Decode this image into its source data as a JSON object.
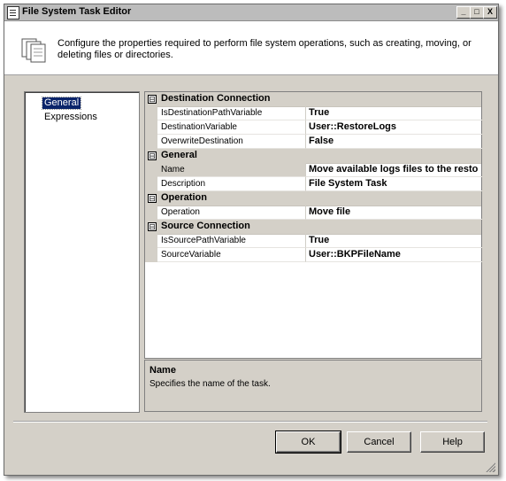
{
  "window": {
    "title": "File System Task Editor"
  },
  "header": {
    "icon": "document-stack-icon",
    "description": "Configure the properties required to perform file system operations, such as creating, moving, or deleting files or directories."
  },
  "nav": {
    "items": [
      {
        "label": "General",
        "selected": true
      },
      {
        "label": "Expressions",
        "selected": false
      }
    ]
  },
  "properties": [
    {
      "category": "Destination Connection",
      "rows": [
        {
          "name": "IsDestinationPathVariable",
          "value": "True"
        },
        {
          "name": "DestinationVariable",
          "value": "User::RestoreLogs"
        },
        {
          "name": "OverwriteDestination",
          "value": "False"
        }
      ]
    },
    {
      "category": "General",
      "rows": [
        {
          "name": "Name",
          "value": "Move available logs files to the resto"
        },
        {
          "name": "Description",
          "value": "File System Task"
        }
      ]
    },
    {
      "category": "Operation",
      "rows": [
        {
          "name": "Operation",
          "value": "Move file"
        }
      ]
    },
    {
      "category": "Source Connection",
      "rows": [
        {
          "name": "IsSourcePathVariable",
          "value": "True"
        },
        {
          "name": "SourceVariable",
          "value": "User::BKPFileName"
        }
      ]
    }
  ],
  "description_panel": {
    "title": "Name",
    "text": "Specifies the name of the task."
  },
  "buttons": {
    "ok": "OK",
    "cancel": "Cancel",
    "help": "Help"
  },
  "titlebar_buttons": {
    "minimize": "_",
    "maximize": "□",
    "close": "X"
  },
  "category_toggle": "⊟"
}
